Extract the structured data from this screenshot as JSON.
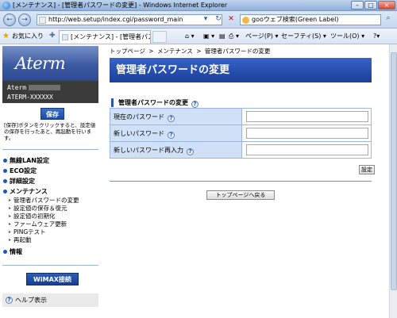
{
  "window": {
    "title": "[メンテナンス] - [管理者パスワードの変更] - Windows Internet Explorer",
    "minimize": "–",
    "maximize": "□",
    "close": "×"
  },
  "addressbar": {
    "back_icon": "←",
    "forward_icon": "→",
    "url": "http://web.setup/index.cgi/password_main",
    "dropdown": "▾",
    "refresh": "↻",
    "stop": "✕",
    "search_text": "gooウェブ検索(Green Label)",
    "search_go": "⌕"
  },
  "favbar": {
    "favorites": "お気に入り",
    "tab_title": "[メンテナンス] - [管理者パスワ...",
    "commands": [
      {
        "label": "⌂ ▾"
      },
      {
        "label": "▣ ▾"
      },
      {
        "label": "▤"
      },
      {
        "label": "⎙ ▾"
      },
      {
        "label": "ページ(P) ▾"
      },
      {
        "label": "セーフティ(S) ▾"
      },
      {
        "label": "ツール(O) ▾"
      },
      {
        "label": "?▾"
      }
    ]
  },
  "sidebar": {
    "logo": "Aterm",
    "model_line1": "Aterm",
    "model_line2": "ATERM-XXXXXX",
    "save_button": "保存",
    "save_note": "[保存]ボタンをクリックすると、設定値の保存を行ったあと、再起動を行います。",
    "menu": {
      "wireless": "無線LAN設定",
      "eco": "ECO設定",
      "detail": "詳細設定",
      "maintenance": "メンテナンス",
      "sub": [
        "管理者パスワードの変更",
        "設定値の保存＆復元",
        "設定値の初期化",
        "ファームウェア更新",
        "PINGテスト",
        "再起動"
      ],
      "info": "情報"
    },
    "wimax_button": "WiMAX接続",
    "help": "ヘルプ表示"
  },
  "main": {
    "breadcrumb": {
      "top": "トップページ",
      "maint": "メンテナンス",
      "current": "管理者パスワードの変更",
      "sep": ">"
    },
    "title": "管理者パスワードの変更",
    "section": "管理者パスワードの変更",
    "fields": {
      "current": "現在のパスワード",
      "new": "新しいパスワード",
      "confirm": "新しいパスワード再入力"
    },
    "set_button": "設定",
    "top_button": "トップページへ戻る"
  }
}
